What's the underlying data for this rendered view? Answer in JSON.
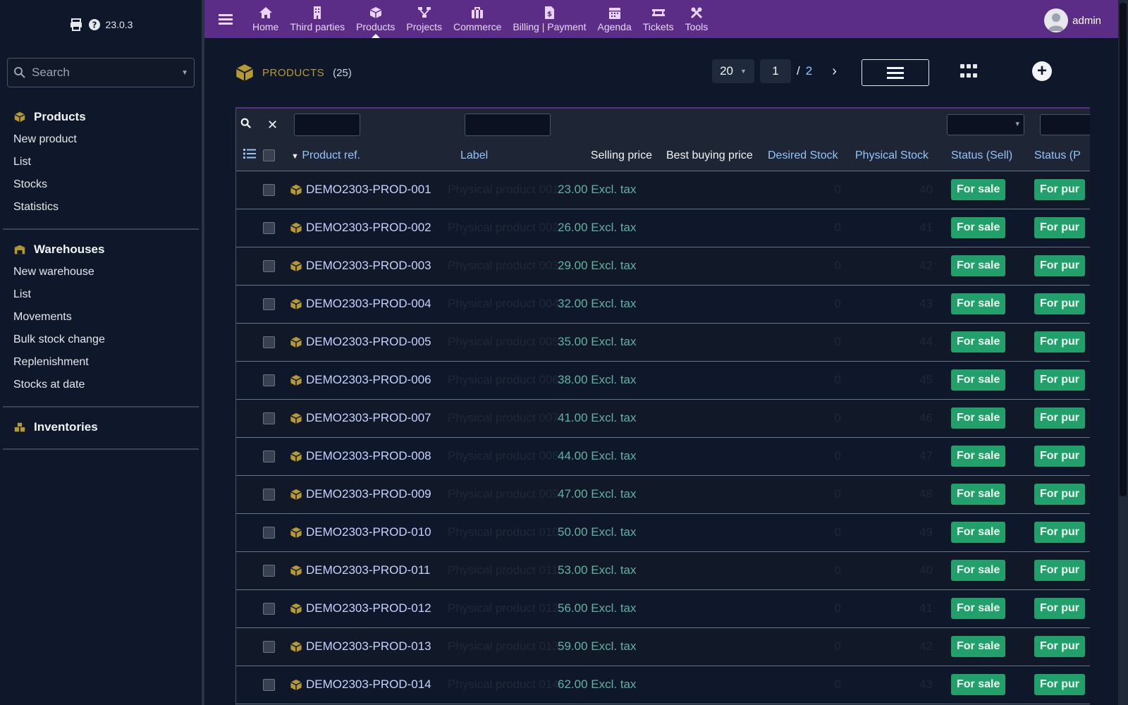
{
  "app": {
    "version": "23.0.3"
  },
  "sidebar": {
    "search_placeholder": "Search",
    "sections": [
      {
        "title": "Products",
        "items": [
          "New product",
          "List",
          "Stocks",
          "Statistics"
        ]
      },
      {
        "title": "Warehouses",
        "items": [
          "New warehouse",
          "List",
          "Movements",
          "Bulk stock change",
          "Replenishment",
          "Stocks at date"
        ]
      },
      {
        "title": "Inventories",
        "items": []
      }
    ]
  },
  "topnav": {
    "items": [
      {
        "label": "Home",
        "icon": "home-icon"
      },
      {
        "label": "Third parties",
        "icon": "building-icon"
      },
      {
        "label": "Products",
        "icon": "cube-icon",
        "active": true
      },
      {
        "label": "Projects",
        "icon": "sitemap-icon"
      },
      {
        "label": "Commerce",
        "icon": "suitcase-icon"
      },
      {
        "label": "Billing | Payment",
        "icon": "invoice-icon"
      },
      {
        "label": "Agenda",
        "icon": "calendar-icon"
      },
      {
        "label": "Tickets",
        "icon": "ticket-icon"
      },
      {
        "label": "Tools",
        "icon": "tools-icon"
      }
    ],
    "user": "admin"
  },
  "page": {
    "title": "PRODUCTS",
    "count": "(25)",
    "per_page": "20",
    "page": "1",
    "slash": "/",
    "total_pages": "2",
    "next": "›"
  },
  "table": {
    "columns": [
      "Product ref.",
      "Label",
      "Selling price",
      "Best buying price",
      "Desired Stock",
      "Physical Stock",
      "Status (Sell)",
      "Status (P"
    ],
    "rows": [
      {
        "ref": "DEMO2303-PROD-001",
        "label": "Physical product 001",
        "price": "23.00 Excl. tax",
        "desired": "0",
        "physical": "40",
        "sell": "For sale",
        "buy": "For pur"
      },
      {
        "ref": "DEMO2303-PROD-002",
        "label": "Physical product 002",
        "price": "26.00 Excl. tax",
        "desired": "0",
        "physical": "41",
        "sell": "For sale",
        "buy": "For pur"
      },
      {
        "ref": "DEMO2303-PROD-003",
        "label": "Physical product 003",
        "price": "29.00 Excl. tax",
        "desired": "0",
        "physical": "42",
        "sell": "For sale",
        "buy": "For pur"
      },
      {
        "ref": "DEMO2303-PROD-004",
        "label": "Physical product 004",
        "price": "32.00 Excl. tax",
        "desired": "0",
        "physical": "43",
        "sell": "For sale",
        "buy": "For pur"
      },
      {
        "ref": "DEMO2303-PROD-005",
        "label": "Physical product 005",
        "price": "35.00 Excl. tax",
        "desired": "0",
        "physical": "44",
        "sell": "For sale",
        "buy": "For pur"
      },
      {
        "ref": "DEMO2303-PROD-006",
        "label": "Physical product 006",
        "price": "38.00 Excl. tax",
        "desired": "0",
        "physical": "45",
        "sell": "For sale",
        "buy": "For pur"
      },
      {
        "ref": "DEMO2303-PROD-007",
        "label": "Physical product 007",
        "price": "41.00 Excl. tax",
        "desired": "0",
        "physical": "46",
        "sell": "For sale",
        "buy": "For pur"
      },
      {
        "ref": "DEMO2303-PROD-008",
        "label": "Physical product 008",
        "price": "44.00 Excl. tax",
        "desired": "0",
        "physical": "47",
        "sell": "For sale",
        "buy": "For pur"
      },
      {
        "ref": "DEMO2303-PROD-009",
        "label": "Physical product 009",
        "price": "47.00 Excl. tax",
        "desired": "0",
        "physical": "48",
        "sell": "For sale",
        "buy": "For pur"
      },
      {
        "ref": "DEMO2303-PROD-010",
        "label": "Physical product 010",
        "price": "50.00 Excl. tax",
        "desired": "0",
        "physical": "49",
        "sell": "For sale",
        "buy": "For pur"
      },
      {
        "ref": "DEMO2303-PROD-011",
        "label": "Physical product 011",
        "price": "53.00 Excl. tax",
        "desired": "0",
        "physical": "40",
        "sell": "For sale",
        "buy": "For pur"
      },
      {
        "ref": "DEMO2303-PROD-012",
        "label": "Physical product 012",
        "price": "56.00 Excl. tax",
        "desired": "0",
        "physical": "41",
        "sell": "For sale",
        "buy": "For pur"
      },
      {
        "ref": "DEMO2303-PROD-013",
        "label": "Physical product 013",
        "price": "59.00 Excl. tax",
        "desired": "0",
        "physical": "42",
        "sell": "For sale",
        "buy": "For pur"
      },
      {
        "ref": "DEMO2303-PROD-014",
        "label": "Physical product 014",
        "price": "62.00 Excl. tax",
        "desired": "0",
        "physical": "43",
        "sell": "For sale",
        "buy": "For pur"
      }
    ]
  },
  "colors": {
    "topbar": "#5b2d86",
    "accent_gold": "#b59a32",
    "badge_green": "#22a06b",
    "price_teal": "#5fb3a3"
  }
}
